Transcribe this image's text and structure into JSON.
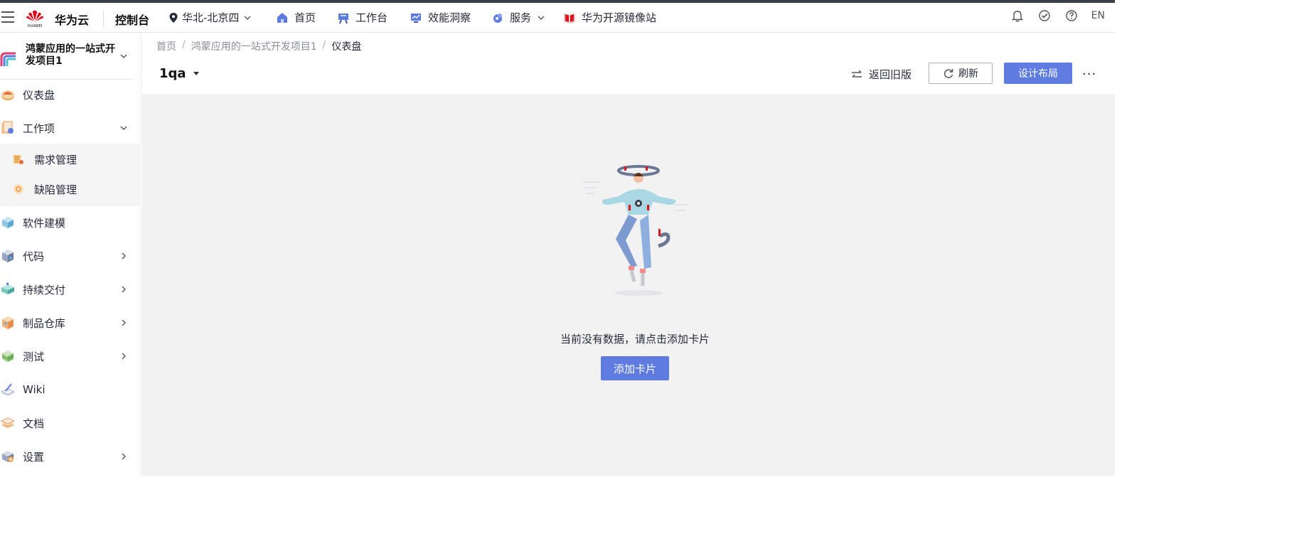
{
  "topbar": {
    "logo_text": "华为云",
    "logo_sub": "HUAWEI",
    "console": "控制台",
    "region": "华北-北京四",
    "nav": [
      {
        "label": "首页",
        "icon": "home-icon"
      },
      {
        "label": "工作台",
        "icon": "workbench-icon"
      },
      {
        "label": "效能洞察",
        "icon": "insight-icon"
      },
      {
        "label": "服务",
        "icon": "service-icon"
      },
      {
        "label": "华为开源镜像站",
        "icon": "mirror-icon"
      }
    ],
    "lang": "EN"
  },
  "sidebar": {
    "project_name": "鸿蒙应用的一站式开发项目1",
    "items": [
      {
        "label": "仪表盘",
        "icon": "dashboard-icon"
      },
      {
        "label": "工作项",
        "icon": "workitem-icon",
        "expanded": true
      },
      {
        "label": "软件建模",
        "icon": "modeling-icon"
      },
      {
        "label": "代码",
        "icon": "code-icon"
      },
      {
        "label": "持续交付",
        "icon": "delivery-icon"
      },
      {
        "label": "制品仓库",
        "icon": "artifact-icon"
      },
      {
        "label": "测试",
        "icon": "test-icon"
      },
      {
        "label": "Wiki",
        "icon": "wiki-icon"
      },
      {
        "label": "文档",
        "icon": "docs-icon"
      },
      {
        "label": "设置",
        "icon": "settings-icon"
      }
    ],
    "sub_items": [
      {
        "label": "需求管理",
        "icon": "requirement-icon"
      },
      {
        "label": "缺陷管理",
        "icon": "bug-icon"
      }
    ]
  },
  "header": {
    "breadcrumb": [
      "首页",
      "鸿蒙应用的一站式开发项目1",
      "仪表盘"
    ],
    "board_name": "1qa",
    "back_old": "返回旧版",
    "refresh": "刷新",
    "design": "设计布局",
    "more": "···"
  },
  "empty": {
    "message": "当前没有数据，请点击添加卡片",
    "add_button": "添加卡片"
  },
  "colors": {
    "primary": "#5e7ce0",
    "content_bg": "#f2f2f3",
    "brand_red": "#e60012"
  }
}
